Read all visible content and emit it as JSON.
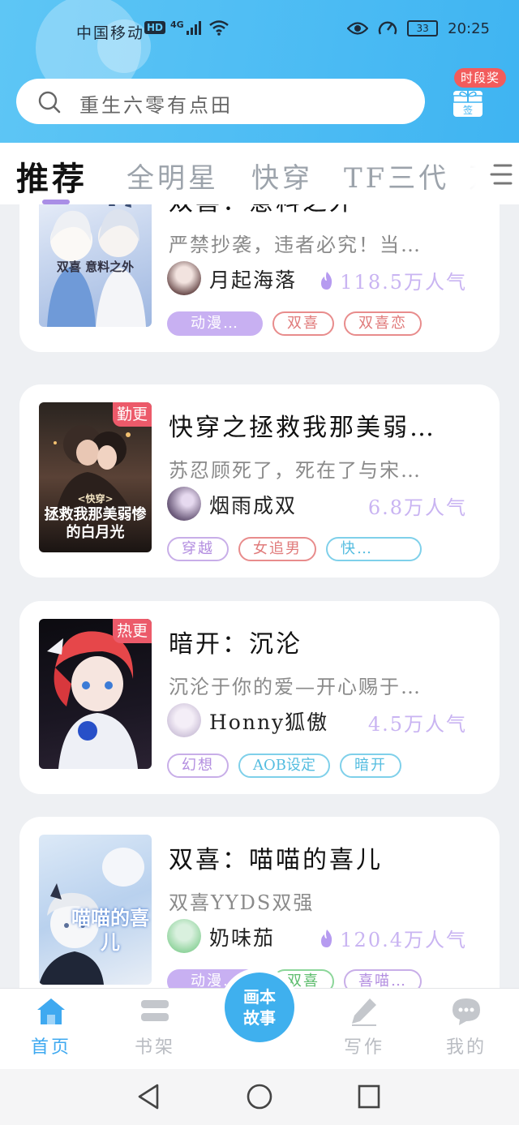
{
  "status_bar": {
    "carrier": "中国移动",
    "hd": "HD",
    "network": "4G",
    "battery": "33",
    "time": "20:25"
  },
  "search": {
    "placeholder": "重生六零有点田"
  },
  "sign_in": {
    "badge": "时段奖",
    "label": "签"
  },
  "tabs": [
    {
      "label": "推荐",
      "active": true
    },
    {
      "label": "全明星"
    },
    {
      "label": "快穿"
    },
    {
      "label": "TF三代"
    },
    {
      "label": "万"
    }
  ],
  "cards": [
    {
      "title": "双喜：意料之外",
      "desc": "严禁抄袭，违者必究！当…",
      "author": "月起海落",
      "popularity": "118.5万人气",
      "hot": true,
      "cover_title": "双喜 意料之外",
      "tags": [
        {
          "label": "动漫…",
          "style": "filled-purple"
        },
        {
          "label": "双喜",
          "style": "red"
        },
        {
          "label": "双喜恋",
          "style": "red"
        }
      ]
    },
    {
      "title": "快穿之拯救我那美弱…",
      "desc": "苏忍顾死了，死在了与宋…",
      "author": "烟雨成双",
      "popularity": "6.8万人气",
      "hot": false,
      "badge": "勤更",
      "cover_title": "拯救我那美弱惨的白月光",
      "cover_subtitle": "<快穿>",
      "tags": [
        {
          "label": "穿越",
          "style": "purple"
        },
        {
          "label": "女追男",
          "style": "red"
        },
        {
          "label": "快…",
          "style": "cyan"
        }
      ]
    },
    {
      "title": "暗开：沉沦",
      "desc": "沉沦于你的爱—开心赐于…",
      "author": "Honny狐傲",
      "popularity": "4.5万人气",
      "hot": false,
      "badge": "热更",
      "tags": [
        {
          "label": "幻想",
          "style": "purple"
        },
        {
          "label": "AOB设定",
          "style": "cyan"
        },
        {
          "label": "暗开",
          "style": "cyan"
        }
      ]
    },
    {
      "title": "双喜：喵喵的喜儿",
      "desc": "双喜YYDS双强",
      "author": "奶味茄",
      "popularity": "120.4万人气",
      "hot": true,
      "cover_title": "喵喵的喜儿",
      "tags": [
        {
          "label": "动漫…",
          "style": "filled-purple"
        },
        {
          "label": "双喜",
          "style": "green"
        },
        {
          "label": "喜喵…",
          "style": "purple"
        }
      ]
    }
  ],
  "bottom_nav": [
    {
      "label": "首页",
      "icon": "home-icon",
      "active": true
    },
    {
      "label": "书架",
      "icon": "bookshelf-icon"
    },
    {
      "label": "写作",
      "icon": "pen-icon"
    },
    {
      "label": "我的",
      "icon": "chat-bubble-icon"
    }
  ],
  "center_button": {
    "line1": "画本",
    "line2": "故事"
  },
  "colors": {
    "header": "#3fb4f2",
    "accent": "#3fa9f0",
    "tab_indicator": "#a98ee6",
    "popularity": "#c9b4f2",
    "badge": "#ec5a6a"
  }
}
